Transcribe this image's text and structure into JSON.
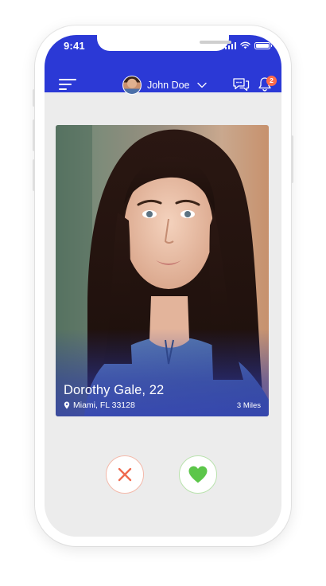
{
  "status_bar": {
    "time": "9:41"
  },
  "header": {
    "user_name": "John Doe",
    "notification_count": "2",
    "icons": {
      "menu": "hamburger-menu-icon",
      "dropdown": "chevron-down-icon",
      "chat": "chat-bubbles-icon",
      "notifications": "bell-icon"
    }
  },
  "profile_card": {
    "name_age": "Dorothy Gale, 22",
    "location": "Miami, FL 33128",
    "distance": "3 Miles",
    "location_icon": "location-pin-icon"
  },
  "actions": {
    "dislike_icon": "close-x-icon",
    "like_icon": "heart-icon"
  },
  "colors": {
    "accent": "#2b39d6",
    "dislike": "#ef6a4f",
    "like": "#5cc64a",
    "badge": "#ff6b4a",
    "screen_background": "#ececec"
  }
}
